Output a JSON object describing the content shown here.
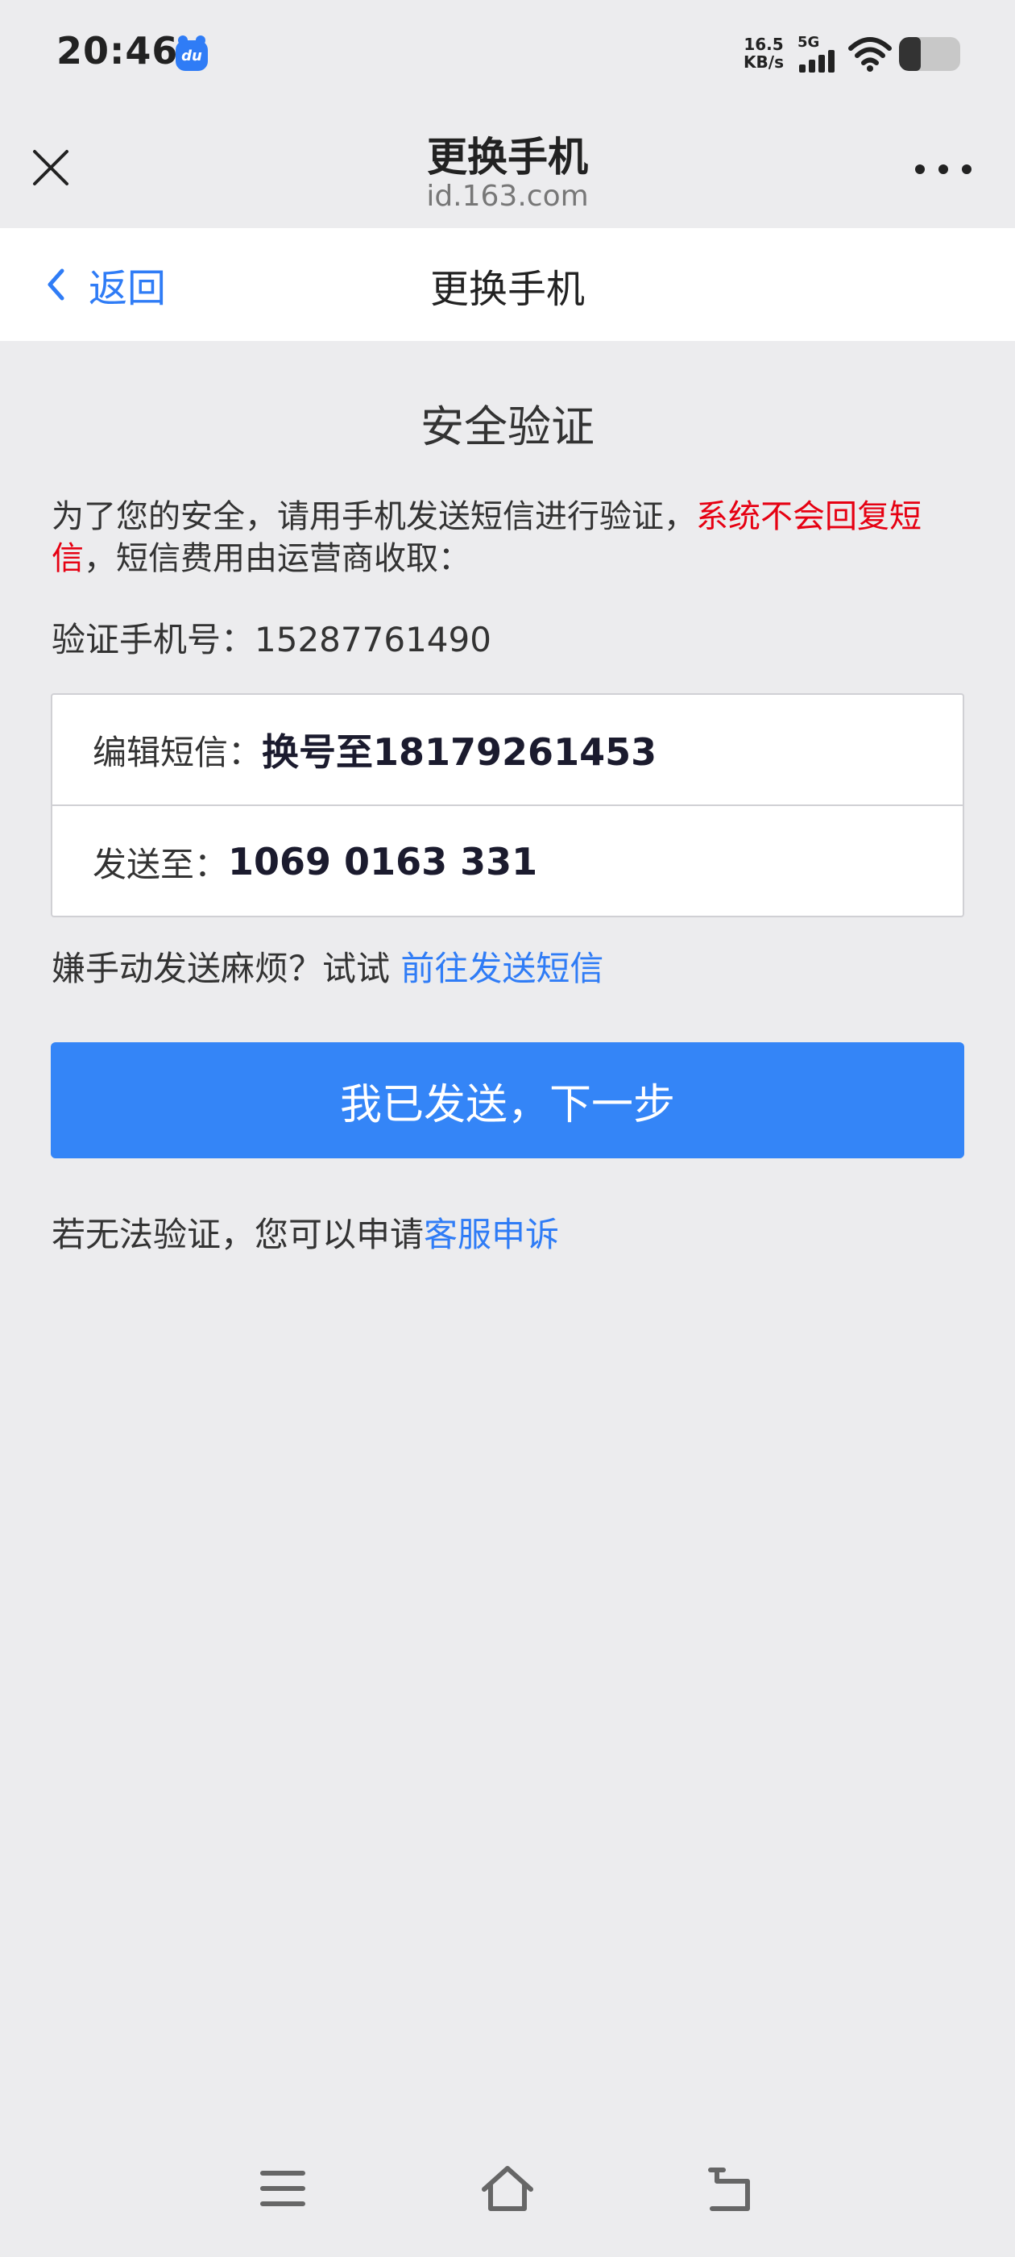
{
  "status_bar": {
    "time": "20:46",
    "app_icon_text": "du",
    "net_speed_value": "16.5",
    "net_speed_unit": "KB/s",
    "network_type": "5G",
    "battery_level": 0.35
  },
  "title_bar": {
    "title": "更换手机",
    "domain": "id.163.com"
  },
  "nav": {
    "back_label": "返回",
    "title": "更换手机"
  },
  "main": {
    "section_title": "安全验证",
    "notice_prefix": "为了您的安全，请用手机发送短信进行验证，",
    "notice_highlight": "系统不会回复短信",
    "notice_suffix": "，短信费用由运营商收取：",
    "phone_label": "验证手机号：",
    "phone_value": "15287761490",
    "sms_edit_label": "编辑短信：",
    "sms_edit_value": "换号至18179261453",
    "sms_to_label": "发送至：",
    "sms_to_value": "1069 0163 331",
    "manual_prefix": "嫌手动发送麻烦？试试 ",
    "manual_link": "前往发送短信",
    "primary_button": "我已发送，下一步",
    "appeal_prefix": "若无法验证，您可以申请",
    "appeal_link": "客服申诉"
  },
  "colors": {
    "accent": "#3485f7",
    "link": "#2f7cf6",
    "warning": "#e60012",
    "background": "#ececee"
  }
}
